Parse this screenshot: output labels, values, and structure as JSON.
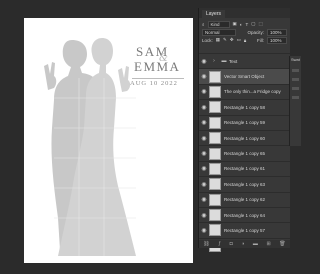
{
  "document": {
    "name_line1": "SAM",
    "ampersand": "&",
    "name_line2": "EMMA",
    "date": "AUG 10 2022"
  },
  "layers_panel": {
    "tab": "Layers",
    "filter_label": "Kind",
    "blend_mode": "Normal",
    "opacity_label": "Opacity:",
    "opacity_value": "100%",
    "lock_label": "Lock:",
    "fill_label": "Fill:",
    "fill_value": "100%",
    "layers": [
      {
        "name": "Text",
        "type": "group"
      },
      {
        "name": "Vector Smart Object",
        "type": "smart"
      },
      {
        "name": "The only thin...a Fridge copy",
        "type": "image"
      },
      {
        "name": "Rectangle 1 copy 58",
        "type": "shape"
      },
      {
        "name": "Rectangle 1 copy 59",
        "type": "shape"
      },
      {
        "name": "Rectangle 1 copy 60",
        "type": "shape"
      },
      {
        "name": "Rectangle 1 copy 65",
        "type": "shape"
      },
      {
        "name": "Rectangle 1 copy 61",
        "type": "shape"
      },
      {
        "name": "Rectangle 1 copy 63",
        "type": "shape"
      },
      {
        "name": "Rectangle 1 copy 62",
        "type": "shape"
      },
      {
        "name": "Rectangle 1 copy 64",
        "type": "shape"
      },
      {
        "name": "Rectangle 1 copy 57",
        "type": "shape"
      },
      {
        "name": "Rectangle 1 copy 47",
        "type": "shape"
      }
    ]
  },
  "side_panel": {
    "tab": "Swat"
  }
}
